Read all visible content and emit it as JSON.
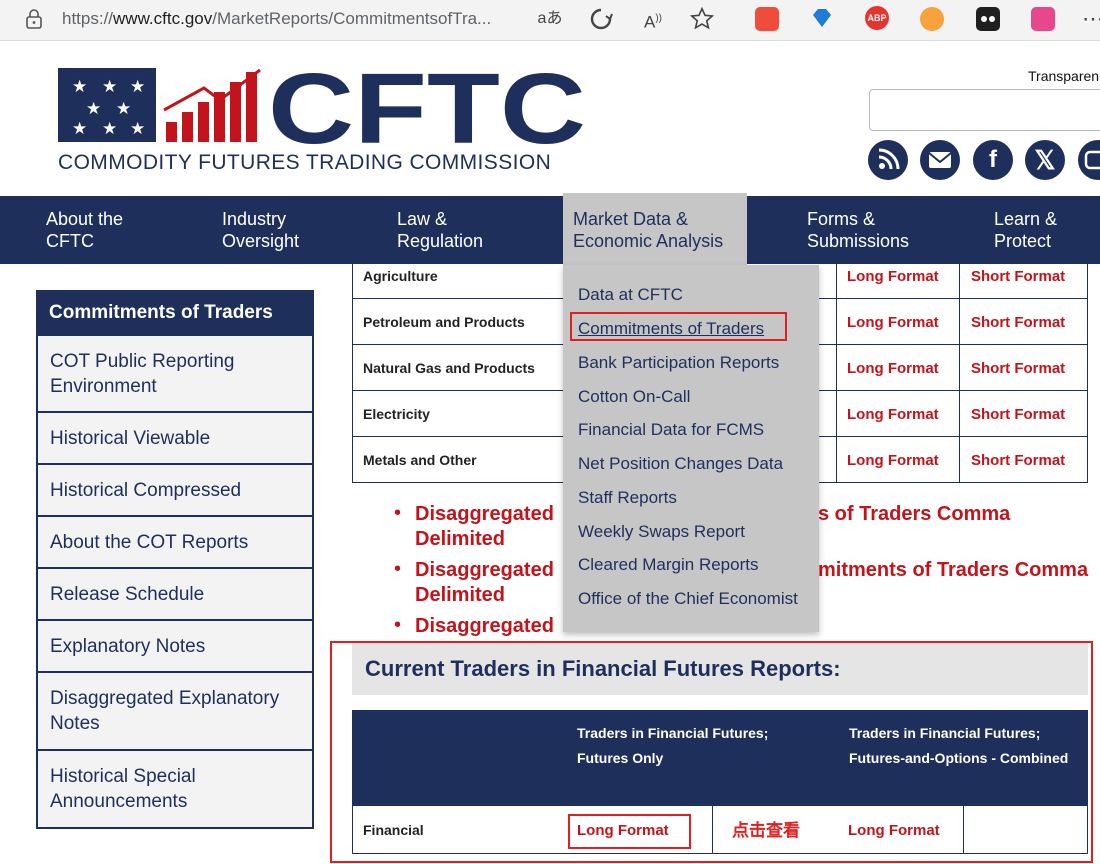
{
  "browser": {
    "url_prefix": "https://",
    "url_domain": "www.cftc.gov",
    "url_path": "/MarketReports/CommitmentsofTra...",
    "read_aloud_glyph": "aあ",
    "reader_glyph": "A)"
  },
  "header": {
    "logo_text": "CFTC",
    "logo_subtitle": "COMMODITY FUTURES TRADING COMMISSION",
    "transparency_label": "Transparen",
    "search_value": "",
    "brand_navy": "#1e2f5c",
    "brand_red": "#c4141b"
  },
  "nav": {
    "items": [
      {
        "line1": "About the",
        "line2": "CFTC"
      },
      {
        "line1": "Industry",
        "line2": "Oversight"
      },
      {
        "line1": "Law &",
        "line2": "Regulation"
      },
      {
        "line1": "Market Data &",
        "line2": "Economic Analysis"
      },
      {
        "line1": "Forms &",
        "line2": "Submissions"
      },
      {
        "line1": "Learn &",
        "line2": "Protect"
      }
    ]
  },
  "dropdown": {
    "items": [
      "Data at CFTC",
      "Commitments of Traders",
      "Bank Participation Reports",
      "Cotton On-Call",
      "Financial Data for FCMS",
      "Net Position Changes Data",
      "Staff Reports",
      "Weekly Swaps Report",
      "Cleared Margin Reports",
      "Office of the Chief Economist"
    ]
  },
  "sidebar": {
    "title": "Commitments of Traders",
    "items": [
      "COT Public Reporting Environment",
      "Historical Viewable",
      "Historical Compressed",
      "About the COT Reports",
      "Release Schedule",
      "Explanatory Notes",
      "Disaggregated Explanatory Notes",
      "Historical Special Announcements"
    ]
  },
  "disaggregated_table": {
    "rows": [
      {
        "label": "Agriculture",
        "long": "Long Format",
        "short": "Short Format"
      },
      {
        "label": "Petroleum and Products",
        "long": "Long Format",
        "short": "Short Format"
      },
      {
        "label": "Natural Gas and Products",
        "long": "Long Format",
        "short": "Short Format"
      },
      {
        "label": "Electricity",
        "long": "Long Format",
        "short": "Short Format"
      },
      {
        "label": "Metals and Other",
        "long": "Long Format",
        "short": "Short Format"
      }
    ]
  },
  "bullets": [
    {
      "left": "Disaggregated ",
      "right": "s of Traders Comma",
      "line2": "Delimited"
    },
    {
      "left": "Disaggregated ",
      "right": "mitments of Traders Comma",
      "line2": "Delimited"
    },
    {
      "left": "Disaggregated ",
      "right": "",
      "line2": ""
    }
  ],
  "financial": {
    "title": "Current Traders in Financial Futures Reports:",
    "col1_header": "Traders in Financial Futures; Futures Only",
    "col2_header": "Traders in Financial Futures; Futures-and-Options - Combined",
    "row_label": "Financial",
    "futures_only_link": "Long Format",
    "combined_link": "Long Format",
    "annotation": "点击查看"
  }
}
